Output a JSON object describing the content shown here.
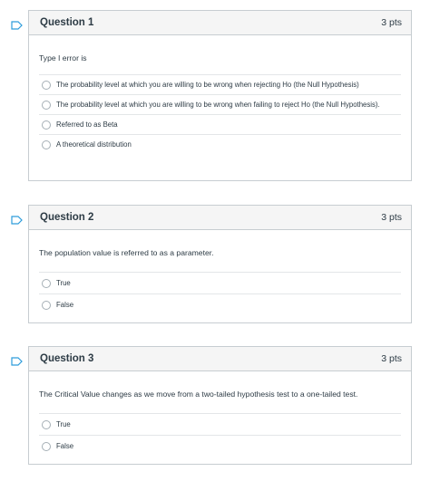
{
  "questions": [
    {
      "title": "Question 1",
      "points": "3 pts",
      "text": "Type I error is",
      "answers": [
        "The probability level at which you are willing to be wrong when rejecting Ho (the Null Hypothesis)",
        "The probability level at which you are willing to be wrong when failing to reject Ho (the Null Hypothesis).",
        "Referred to as Beta",
        "A theoretical distribution"
      ]
    },
    {
      "title": "Question 2",
      "points": "3 pts",
      "text": "The population value is referred to as a parameter.",
      "answers": [
        "True",
        "False"
      ]
    },
    {
      "title": "Question 3",
      "points": "3 pts",
      "text": "The Critical Value changes as we move from a two-tailed hypothesis test to a one-tailed test.",
      "answers": [
        "True",
        "False"
      ]
    }
  ],
  "colors": {
    "flag": "#2d9cdb",
    "border": "#c7cdd1",
    "header_bg": "#f5f5f5",
    "text": "#2d3b45"
  }
}
